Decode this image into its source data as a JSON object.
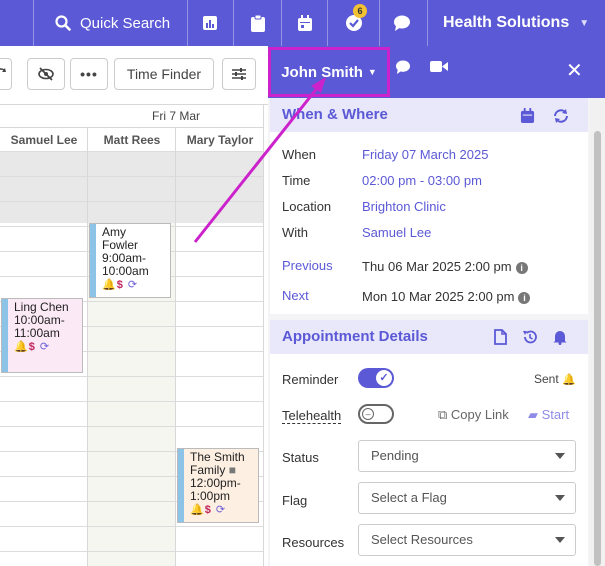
{
  "topbar": {
    "quick_search_label": "Quick Search",
    "notification_count": "6",
    "org_name": "Health Solutions",
    "accent": "#5b59d6"
  },
  "toolbar": {
    "time_finder_label": "Time Finder"
  },
  "calendar": {
    "day_header": "Fri 7 Mar",
    "columns": [
      "Samuel Lee",
      "Matt Rees",
      "Mary Taylor"
    ],
    "appointments": [
      {
        "name": "Amy Fowler",
        "line1": "Amy",
        "line2": "Fowler",
        "time1": "9:00am-",
        "time2": "10:00am",
        "bar_color": "#8ec3e8",
        "bg": "#ffffff"
      },
      {
        "name": "Ling Chen",
        "line1": "Ling Chen",
        "time1": "10:00am-",
        "time2": "11:00am",
        "bar_color": "#8ec3e8",
        "bg": "#fbe9f6"
      },
      {
        "name": "The Smith Family",
        "line1": "The Smith",
        "line2": "Family",
        "time1": "12:00pm-",
        "time2": "1:00pm",
        "bar_color": "#8ec3e8",
        "bg": "#fdf0e2"
      }
    ]
  },
  "panel": {
    "patient_name": "John Smith",
    "when_where": {
      "title": "When & Where",
      "when_label": "When",
      "when_value": "Friday 07 March 2025",
      "time_label": "Time",
      "time_value": "02:00 pm - 03:00 pm",
      "location_label": "Location",
      "location_value": "Brighton Clinic",
      "with_label": "With",
      "with_value": "Samuel Lee",
      "previous_label": "Previous",
      "previous_value": "Thu 06 Mar 2025 2:00 pm",
      "next_label": "Next",
      "next_value": "Mon 10 Mar 2025 2:00 pm"
    },
    "details": {
      "title": "Appointment Details",
      "reminder_label": "Reminder",
      "reminder_status": "Sent",
      "telehealth_label": "Telehealth",
      "copy_link_label": "Copy Link",
      "start_label": "Start",
      "status_label": "Status",
      "status_value": "Pending",
      "flag_label": "Flag",
      "flag_placeholder": "Select a Flag",
      "resources_label": "Resources",
      "resources_placeholder": "Select Resources"
    }
  }
}
